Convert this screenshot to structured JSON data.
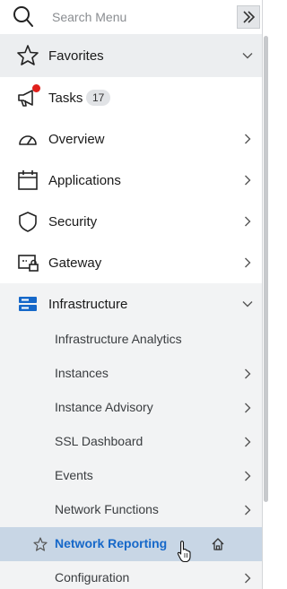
{
  "search": {
    "placeholder": "Search Menu"
  },
  "nav": {
    "favorites": "Favorites",
    "tasks": {
      "label": "Tasks",
      "count": "17"
    },
    "overview": "Overview",
    "applications": "Applications",
    "security": "Security",
    "gateway": "Gateway",
    "infrastructure": "Infrastructure"
  },
  "infrastructure_items": [
    {
      "label": "Infrastructure Analytics"
    },
    {
      "label": "Instances"
    },
    {
      "label": "Instance Advisory"
    },
    {
      "label": "SSL Dashboard"
    },
    {
      "label": "Events"
    },
    {
      "label": "Network Functions"
    },
    {
      "label": "Network Reporting"
    },
    {
      "label": "Configuration"
    }
  ],
  "colors": {
    "accent": "#1668c9",
    "active_bg": "#c8d6e5",
    "notification": "#e0201c"
  }
}
